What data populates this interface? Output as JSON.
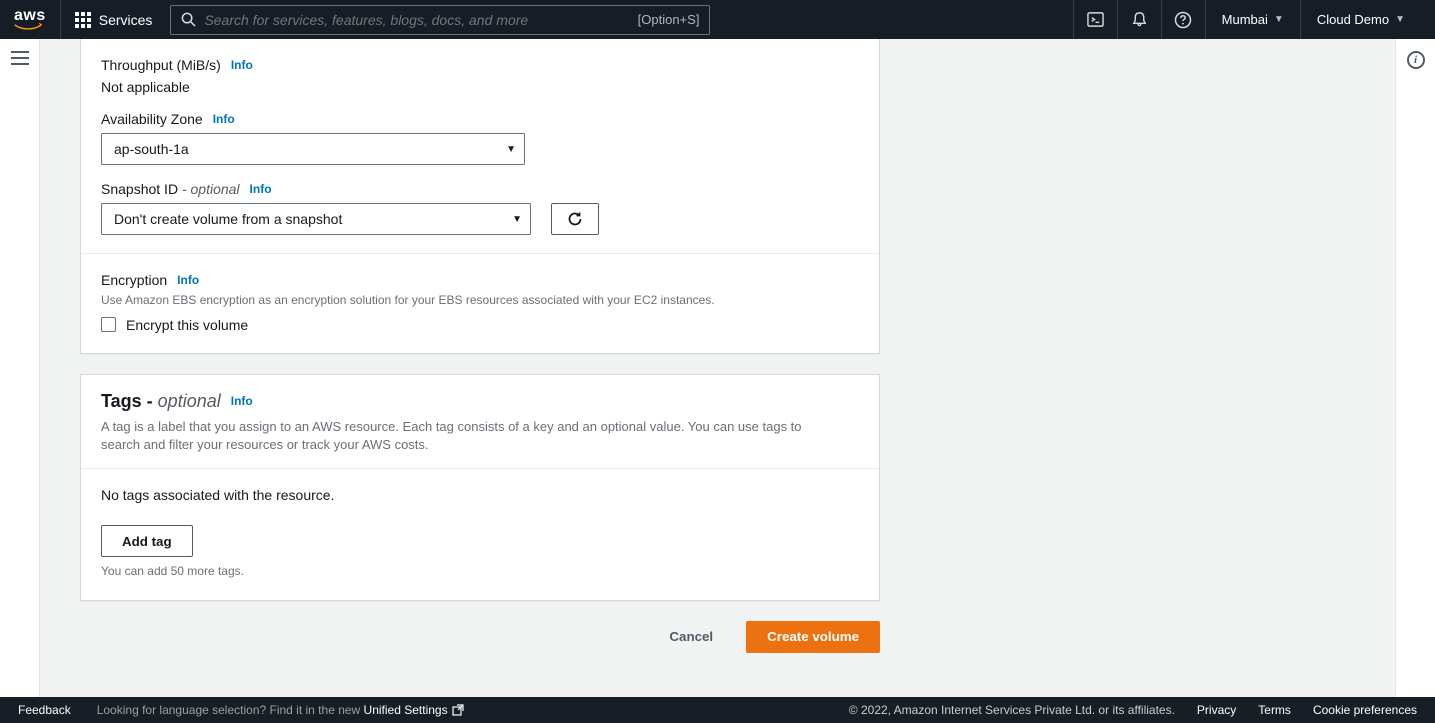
{
  "nav": {
    "services_label": "Services",
    "search_placeholder": "Search for services, features, blogs, docs, and more",
    "search_shortcut": "[Option+S]",
    "region": "Mumbai",
    "account": "Cloud Demo"
  },
  "form": {
    "throughput": {
      "label": "Throughput (MiB/s)",
      "info": "Info",
      "value": "Not applicable"
    },
    "az": {
      "label": "Availability Zone",
      "info": "Info",
      "value": "ap-south-1a"
    },
    "snapshot": {
      "label": "Snapshot ID",
      "optional_suffix": " - optional",
      "info": "Info",
      "value": "Don't create volume from a snapshot"
    },
    "encryption": {
      "label": "Encryption",
      "info": "Info",
      "hint": "Use Amazon EBS encryption as an encryption solution for your EBS resources associated with your EC2 instances.",
      "checkbox_label": "Encrypt this volume",
      "checked": false
    }
  },
  "tags": {
    "title_prefix": "Tags - ",
    "title_suffix": "optional",
    "info": "Info",
    "description": "A tag is a label that you assign to an AWS resource. Each tag consists of a key and an optional value. You can use tags to search and filter your resources or track your AWS costs.",
    "empty_text": "No tags associated with the resource.",
    "add_btn": "Add tag",
    "remaining_hint": "You can add 50 more tags."
  },
  "actions": {
    "cancel": "Cancel",
    "submit": "Create volume"
  },
  "footer": {
    "feedback": "Feedback",
    "lang_hint": "Looking for language selection? Find it in the new ",
    "unified": "Unified Settings",
    "copyright": "© 2022, Amazon Internet Services Private Ltd. or its affiliates.",
    "privacy": "Privacy",
    "terms": "Terms",
    "cookie": "Cookie preferences"
  }
}
